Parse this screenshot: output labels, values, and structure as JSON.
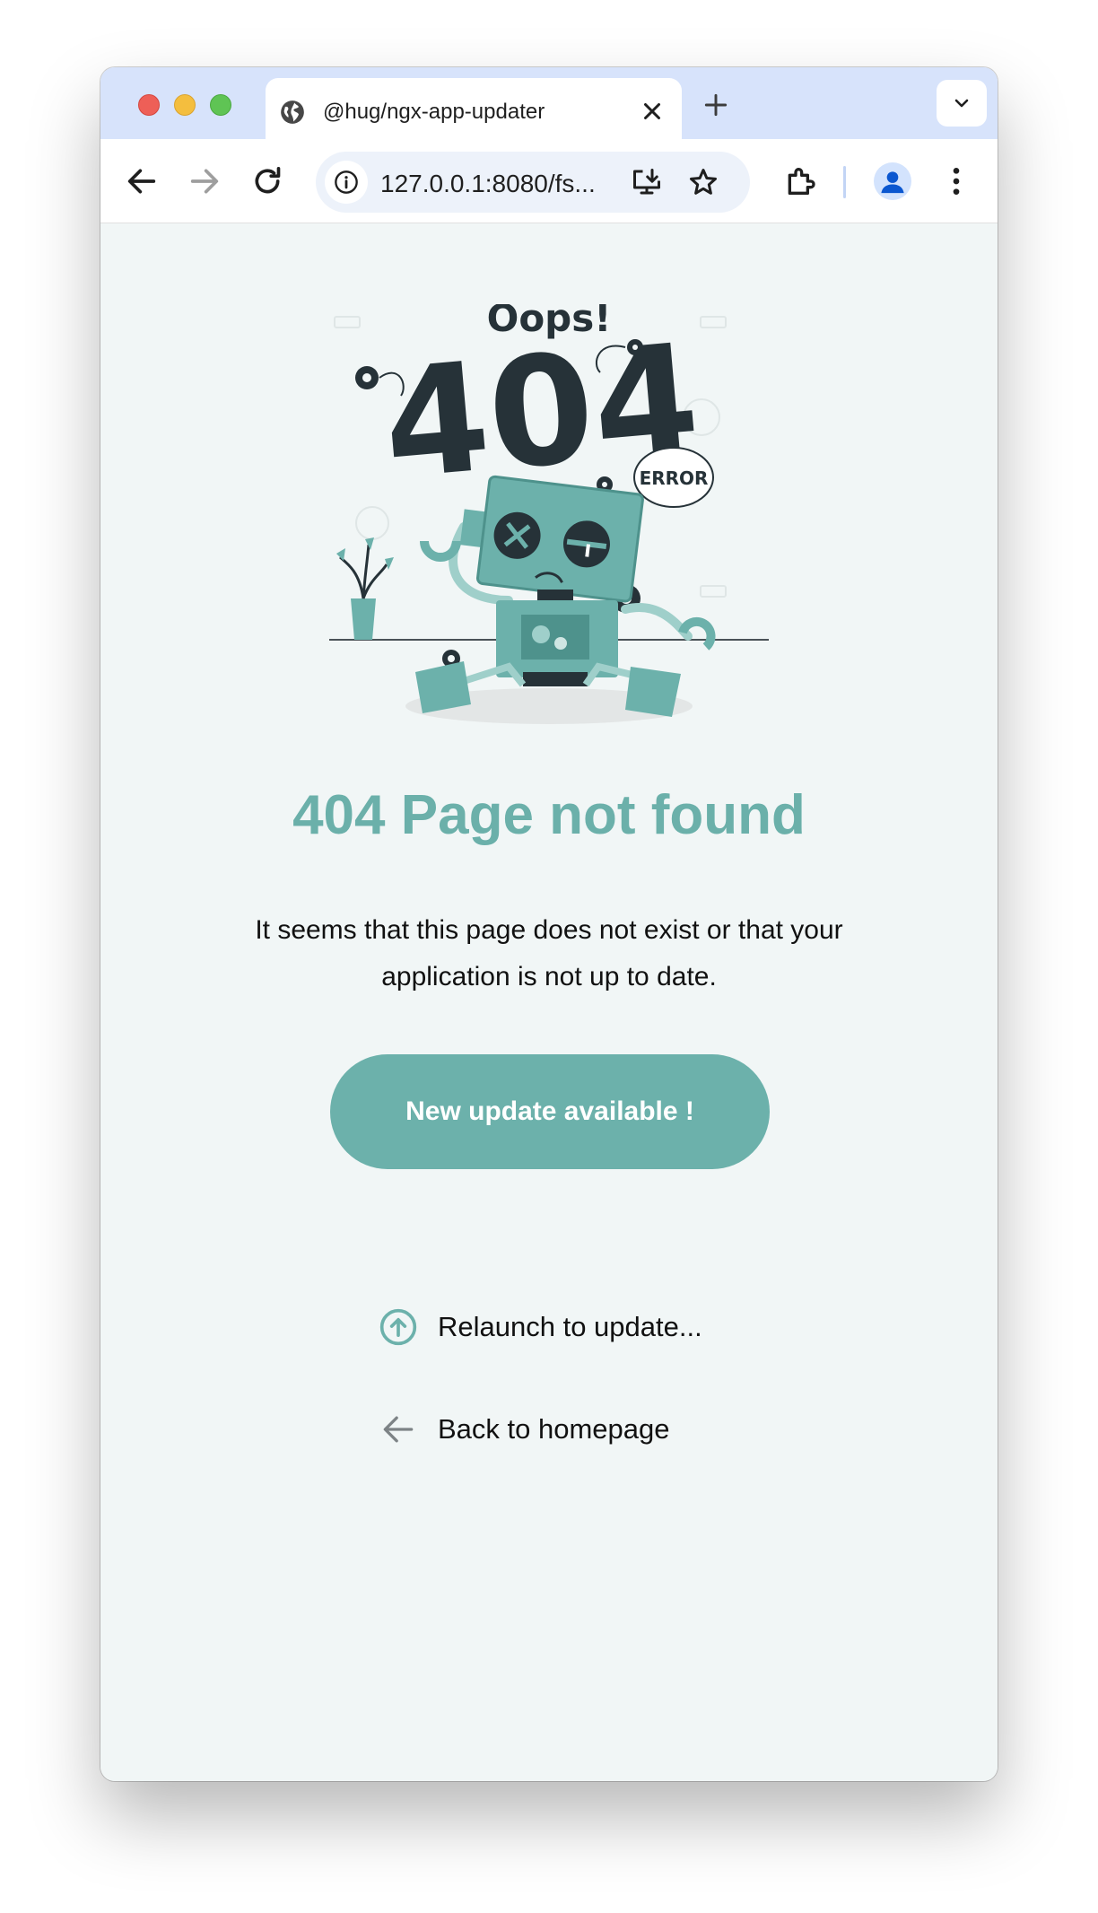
{
  "browser": {
    "tab_title": "@hug/ngx-app-updater",
    "url": "127.0.0.1:8080/fs..."
  },
  "illustration": {
    "oops_text": "Oops!",
    "big_number": "404",
    "bubble_text": "ERROR"
  },
  "page": {
    "title": "404 Page not found",
    "description": "It seems that this page does not exist or that your application is not up to date.",
    "update_button": "New update available !",
    "relaunch_link": "Relaunch to update...",
    "back_link": "Back to homepage"
  },
  "colors": {
    "accent": "#6cb1ab",
    "dark": "#263238",
    "background": "#f1f6f6"
  },
  "icons": [
    "globe-icon",
    "close-icon",
    "plus-icon",
    "chevron-down-icon",
    "back-arrow-icon",
    "forward-arrow-icon",
    "reload-icon",
    "info-icon",
    "install-app-icon",
    "star-icon",
    "extensions-icon",
    "profile-icon",
    "more-vert-icon",
    "arrow-up-circle-icon",
    "arrow-left-icon"
  ]
}
